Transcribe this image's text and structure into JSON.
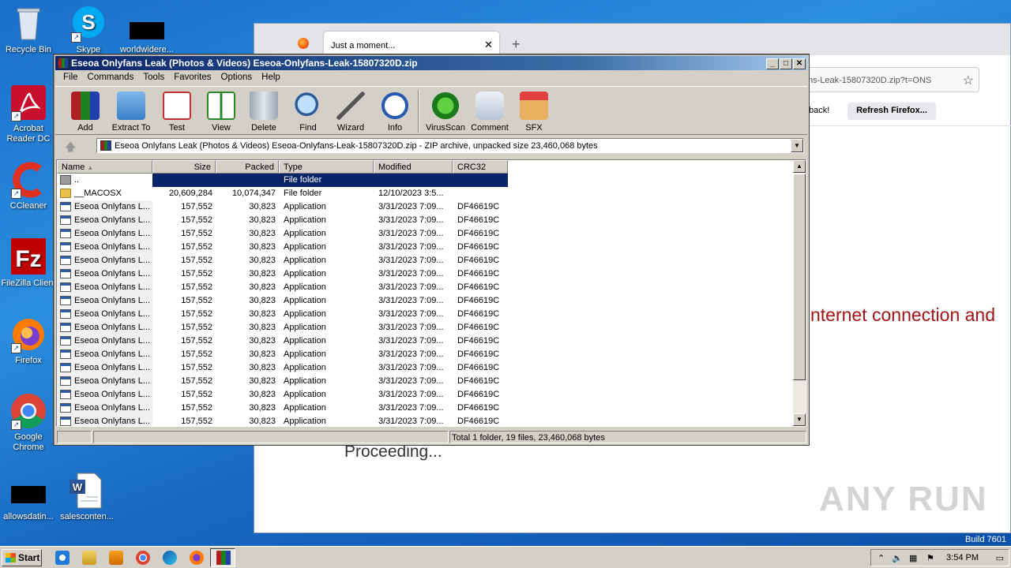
{
  "desktop": {
    "icons": [
      {
        "label": "Recycle Bin"
      },
      {
        "label": "Skype"
      },
      {
        "label": "worldwidere..."
      },
      {
        "label": "Acrobat Reader DC"
      },
      {
        "label": "CCleaner"
      },
      {
        "label": "FileZilla Client"
      },
      {
        "label": "Firefox"
      },
      {
        "label": "Google Chrome"
      },
      {
        "label": "allowsdatin..."
      },
      {
        "label": "salesconten..."
      }
    ],
    "build_text": "Build 7601"
  },
  "firefox": {
    "tab_title": "Just a moment...",
    "new_tab": "+",
    "url_partial": "ns-Leak-15807320D.zip?t=ONS",
    "feedback_partial": "back!",
    "refresh_button": "Refresh Firefox...",
    "error_partial": "nternet connection and",
    "proceeding": "Proceeding..."
  },
  "watermark": "ANY RUN",
  "winrar": {
    "title": "Eseoa Onlyfans Leak (Photos & Videos) Eseoa-Onlyfans-Leak-15807320D.zip",
    "menu": [
      "File",
      "Commands",
      "Tools",
      "Favorites",
      "Options",
      "Help"
    ],
    "tools": [
      "Add",
      "Extract To",
      "Test",
      "View",
      "Delete",
      "Find",
      "Wizard",
      "Info",
      "VirusScan",
      "Comment",
      "SFX"
    ],
    "path_text": "Eseoa Onlyfans Leak (Photos & Videos) Eseoa-Onlyfans-Leak-15807320D.zip - ZIP archive, unpacked size 23,460,068 bytes",
    "columns": [
      "Name",
      "Size",
      "Packed",
      "Type",
      "Modified",
      "CRC32"
    ],
    "rows": [
      {
        "name": "..",
        "size": "",
        "packed": "",
        "type": "File folder",
        "modified": "",
        "crc": ""
      },
      {
        "name": "__MACOSX",
        "size": "20,609,284",
        "packed": "10,074,347",
        "type": "File folder",
        "modified": "12/10/2023 3:5...",
        "crc": ""
      },
      {
        "name": "Eseoa Onlyfans L...",
        "size": "157,552",
        "packed": "30,823",
        "type": "Application",
        "modified": "3/31/2023 7:09...",
        "crc": "DF46619C"
      },
      {
        "name": "Eseoa Onlyfans L...",
        "size": "157,552",
        "packed": "30,823",
        "type": "Application",
        "modified": "3/31/2023 7:09...",
        "crc": "DF46619C"
      },
      {
        "name": "Eseoa Onlyfans L...",
        "size": "157,552",
        "packed": "30,823",
        "type": "Application",
        "modified": "3/31/2023 7:09...",
        "crc": "DF46619C"
      },
      {
        "name": "Eseoa Onlyfans L...",
        "size": "157,552",
        "packed": "30,823",
        "type": "Application",
        "modified": "3/31/2023 7:09...",
        "crc": "DF46619C"
      },
      {
        "name": "Eseoa Onlyfans L...",
        "size": "157,552",
        "packed": "30,823",
        "type": "Application",
        "modified": "3/31/2023 7:09...",
        "crc": "DF46619C"
      },
      {
        "name": "Eseoa Onlyfans L...",
        "size": "157,552",
        "packed": "30,823",
        "type": "Application",
        "modified": "3/31/2023 7:09...",
        "crc": "DF46619C"
      },
      {
        "name": "Eseoa Onlyfans L...",
        "size": "157,552",
        "packed": "30,823",
        "type": "Application",
        "modified": "3/31/2023 7:09...",
        "crc": "DF46619C"
      },
      {
        "name": "Eseoa Onlyfans L...",
        "size": "157,552",
        "packed": "30,823",
        "type": "Application",
        "modified": "3/31/2023 7:09...",
        "crc": "DF46619C"
      },
      {
        "name": "Eseoa Onlyfans L...",
        "size": "157,552",
        "packed": "30,823",
        "type": "Application",
        "modified": "3/31/2023 7:09...",
        "crc": "DF46619C"
      },
      {
        "name": "Eseoa Onlyfans L...",
        "size": "157,552",
        "packed": "30,823",
        "type": "Application",
        "modified": "3/31/2023 7:09...",
        "crc": "DF46619C"
      },
      {
        "name": "Eseoa Onlyfans L...",
        "size": "157,552",
        "packed": "30,823",
        "type": "Application",
        "modified": "3/31/2023 7:09...",
        "crc": "DF46619C"
      },
      {
        "name": "Eseoa Onlyfans L...",
        "size": "157,552",
        "packed": "30,823",
        "type": "Application",
        "modified": "3/31/2023 7:09...",
        "crc": "DF46619C"
      },
      {
        "name": "Eseoa Onlyfans L...",
        "size": "157,552",
        "packed": "30,823",
        "type": "Application",
        "modified": "3/31/2023 7:09...",
        "crc": "DF46619C"
      },
      {
        "name": "Eseoa Onlyfans L...",
        "size": "157,552",
        "packed": "30,823",
        "type": "Application",
        "modified": "3/31/2023 7:09...",
        "crc": "DF46619C"
      },
      {
        "name": "Eseoa Onlyfans L...",
        "size": "157,552",
        "packed": "30,823",
        "type": "Application",
        "modified": "3/31/2023 7:09...",
        "crc": "DF46619C"
      },
      {
        "name": "Eseoa Onlyfans L...",
        "size": "157,552",
        "packed": "30,823",
        "type": "Application",
        "modified": "3/31/2023 7:09...",
        "crc": "DF46619C"
      },
      {
        "name": "Eseoa Onlyfans L...",
        "size": "157,552",
        "packed": "30,823",
        "type": "Application",
        "modified": "3/31/2023 7:09...",
        "crc": "DF46619C"
      }
    ],
    "status": "Total 1 folder, 19 files, 23,460,068 bytes"
  },
  "taskbar": {
    "start": "Start",
    "clock": "3:54 PM"
  }
}
